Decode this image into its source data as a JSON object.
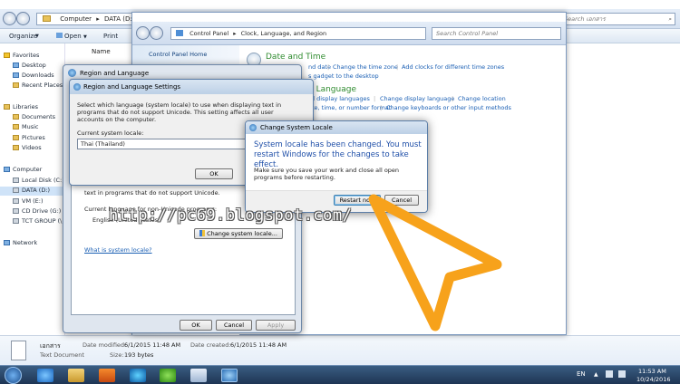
{
  "explorer": {
    "breadcrumb": [
      "Computer",
      "DATA (D:)"
    ],
    "search_placeholder": "Search เอกสาร",
    "toolbar": {
      "organize": "Organize",
      "open": "Open",
      "print": "Print"
    },
    "column_name": "Name",
    "nav": [
      {
        "label": "Favorites",
        "group": true
      },
      {
        "label": "Desktop"
      },
      {
        "label": "Downloads"
      },
      {
        "label": "Recent Places"
      },
      {
        "label": "Libraries",
        "group": true
      },
      {
        "label": "Documents"
      },
      {
        "label": "Music"
      },
      {
        "label": "Pictures"
      },
      {
        "label": "Videos"
      },
      {
        "label": "Computer",
        "group": true
      },
      {
        "label": "Local Disk (C:)"
      },
      {
        "label": "DATA (D:)"
      },
      {
        "label": "VM (E:)"
      },
      {
        "label": "CD Drive (G:) V"
      },
      {
        "label": "TCT GROUP (\\"
      },
      {
        "label": "Network",
        "group": true
      }
    ],
    "details": {
      "file_name": "เอกสาร",
      "file_type": "Text Document",
      "modified_label": "Date modified:",
      "modified_value": "6/1/2015 11:48 AM",
      "created_label": "Date created:",
      "created_value": "6/1/2015 11:48 AM",
      "size_label": "Size:",
      "size_value": "193 bytes"
    }
  },
  "control_panel": {
    "breadcrumb": [
      "Control Panel",
      "Clock, Language, and Region"
    ],
    "search_placeholder": "Search Control Panel",
    "home_link": "Control Panel Home",
    "section1": {
      "heading": "Date and Time",
      "links": [
        "nd date",
        "Change the time zone",
        "Add clocks for different time zones"
      ],
      "link2": "s gadget to the desktop"
    },
    "section2": {
      "heading": "d Language",
      "links": [
        "Install or uninstall display languages",
        "Change display language",
        "Change location"
      ],
      "links2": [
        "ate, time, or number format",
        "Change keyboards or other input methods"
      ]
    }
  },
  "region_dialog": {
    "title": "Region and Language",
    "text_partial": "text in programs that do not support Unicode.",
    "current_label": "Current language for non-Unicode programs:",
    "current_value": "English (United States)",
    "change_button": "Change system locale...",
    "link": "What is system locale?",
    "ok": "OK",
    "cancel": "Cancel",
    "apply": "Apply"
  },
  "settings_dialog": {
    "title": "Region and Language Settings",
    "description": "Select which language (system locale) to use when displaying text in programs that do not support Unicode. This setting affects all user accounts on the computer.",
    "locale_label": "Current system locale:",
    "locale_value": "Thai (Thailand)",
    "ok": "OK"
  },
  "locale_dialog": {
    "title": "Change System Locale",
    "message": "System locale has been changed. You must restart Windows for the changes to take effect.",
    "note": "Make sure you save your work and close all open programs before restarting.",
    "restart": "Restart now",
    "cancel": "Cancel"
  },
  "watermark": "http://pc69.blogspot.com/",
  "taskbar": {
    "language": "EN",
    "time": "11:53 AM",
    "date": "10/24/2016"
  },
  "colors": {
    "accent_arrow": "#f7a21b",
    "link": "#1a5fb4",
    "heading_green": "#2e8b2e",
    "locale_text": "#1f4fa8"
  }
}
